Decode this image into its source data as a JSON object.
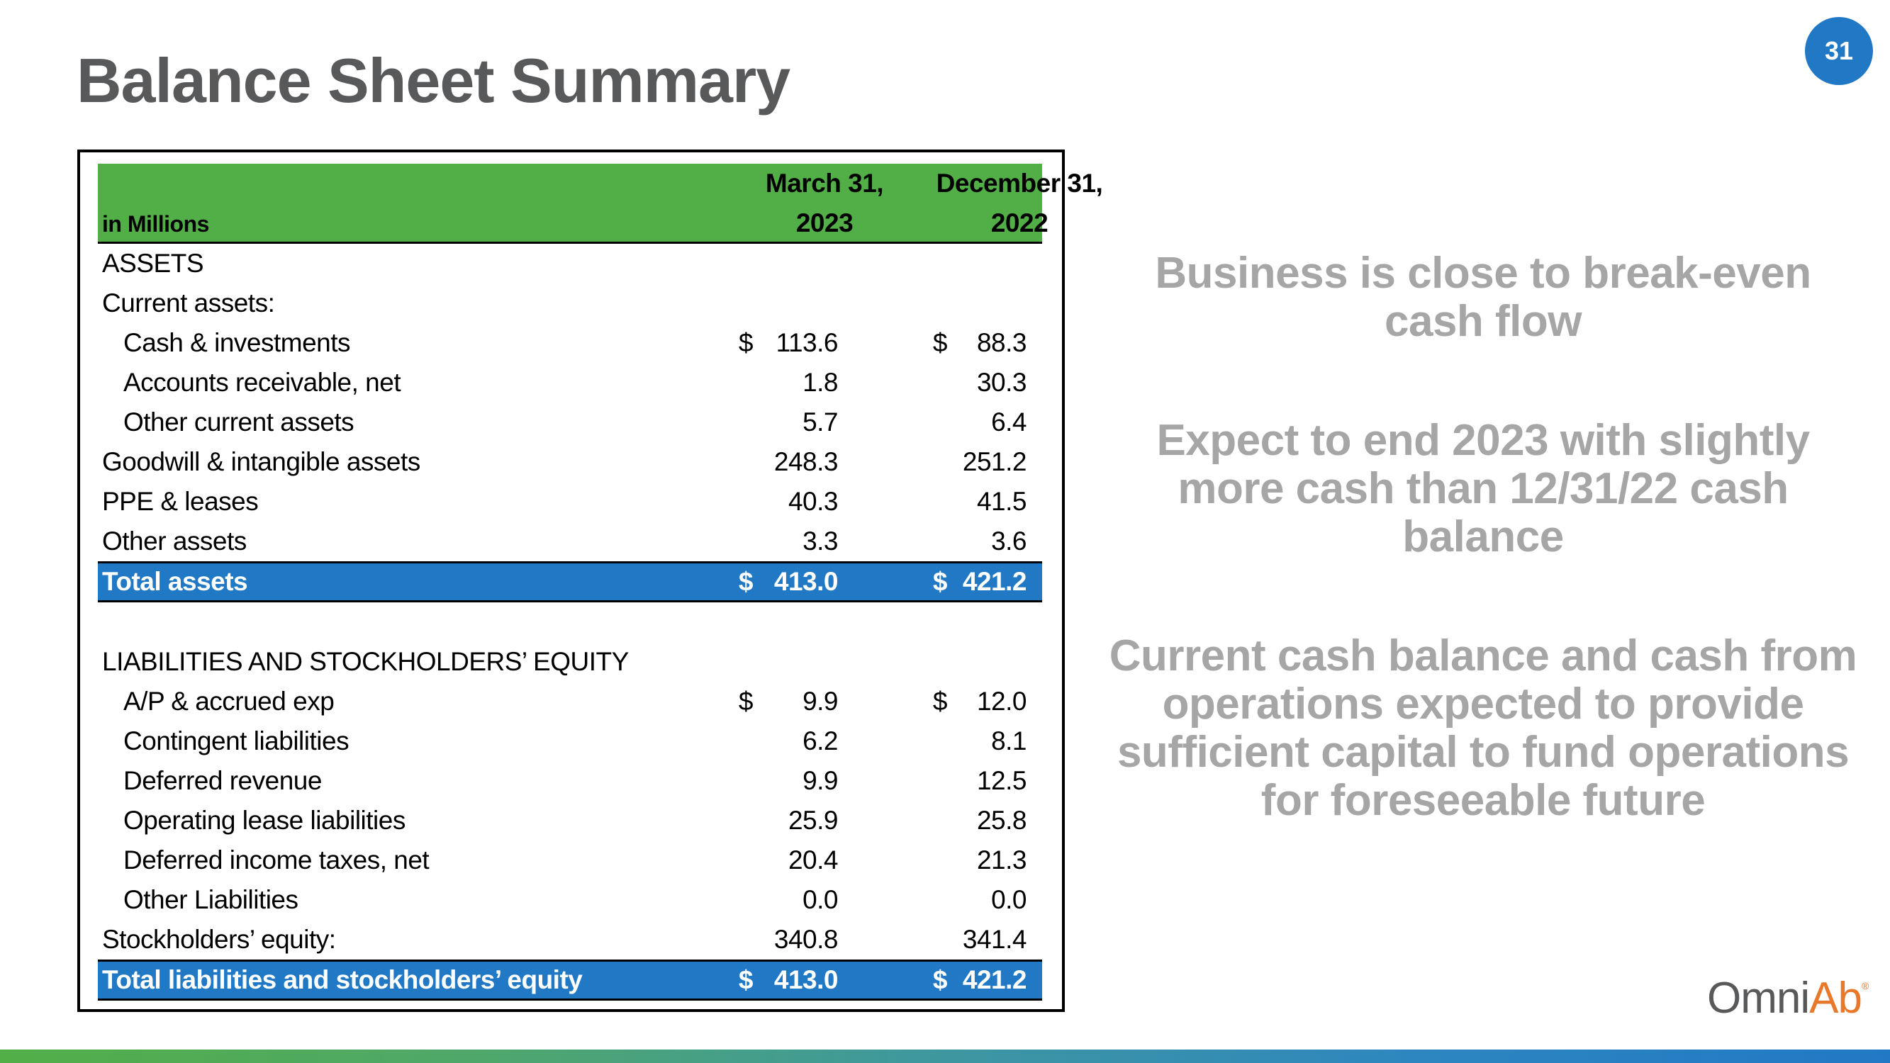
{
  "slide": {
    "title": "Balance Sheet Summary",
    "page_number": "31",
    "colors": {
      "header_green": "#52AE47",
      "total_blue": "#2179C5",
      "title_gray": "#58595B",
      "bullet_gray": "#A6A6A6",
      "logo_orange": "#E8782A"
    }
  },
  "table": {
    "units_label": "in Millions",
    "columns": [
      {
        "line1": "March 31,",
        "line2": "2023"
      },
      {
        "line1": "December 31,",
        "line2": "2022"
      }
    ],
    "rows": [
      {
        "label": "ASSETS",
        "indent": false,
        "cur1": "",
        "v1": "",
        "cur2": "",
        "v2": "",
        "type": "section"
      },
      {
        "label": "Current assets:",
        "indent": false,
        "cur1": "",
        "v1": "",
        "cur2": "",
        "v2": "",
        "type": "subhead"
      },
      {
        "label": "Cash & investments",
        "indent": true,
        "cur1": "$",
        "v1": "113.6",
        "cur2": "$",
        "v2": "88.3",
        "type": "line"
      },
      {
        "label": "Accounts receivable, net",
        "indent": true,
        "cur1": "",
        "v1": "1.8",
        "cur2": "",
        "v2": "30.3",
        "type": "line"
      },
      {
        "label": "Other current assets",
        "indent": true,
        "cur1": "",
        "v1": "5.7",
        "cur2": "",
        "v2": "6.4",
        "type": "line"
      },
      {
        "label": "Goodwill & intangible assets",
        "indent": false,
        "cur1": "",
        "v1": "248.3",
        "cur2": "",
        "v2": "251.2",
        "type": "line"
      },
      {
        "label": "PPE & leases",
        "indent": false,
        "cur1": "",
        "v1": "40.3",
        "cur2": "",
        "v2": "41.5",
        "type": "line"
      },
      {
        "label": "Other assets",
        "indent": false,
        "cur1": "",
        "v1": "3.3",
        "cur2": "",
        "v2": "3.6",
        "type": "line"
      },
      {
        "label": "Total assets",
        "indent": false,
        "cur1": "$",
        "v1": "413.0",
        "cur2": "$",
        "v2": "421.2",
        "type": "total"
      },
      {
        "label": "",
        "indent": false,
        "cur1": "",
        "v1": "",
        "cur2": "",
        "v2": "",
        "type": "spacer"
      },
      {
        "label": "LIABILITIES AND STOCKHOLDERS’ EQUITY",
        "indent": false,
        "cur1": "",
        "v1": "",
        "cur2": "",
        "v2": "",
        "type": "section"
      },
      {
        "label": "A/P & accrued exp",
        "indent": true,
        "cur1": "$",
        "v1": "9.9",
        "cur2": "$",
        "v2": "12.0",
        "type": "line"
      },
      {
        "label": "Contingent liabilities",
        "indent": true,
        "cur1": "",
        "v1": "6.2",
        "cur2": "",
        "v2": "8.1",
        "type": "line"
      },
      {
        "label": "Deferred revenue",
        "indent": true,
        "cur1": "",
        "v1": "9.9",
        "cur2": "",
        "v2": "12.5",
        "type": "line"
      },
      {
        "label": "Operating lease liabilities",
        "indent": true,
        "cur1": "",
        "v1": "25.9",
        "cur2": "",
        "v2": "25.8",
        "type": "line"
      },
      {
        "label": "Deferred income taxes, net",
        "indent": true,
        "cur1": "",
        "v1": "20.4",
        "cur2": "",
        "v2": "21.3",
        "type": "line"
      },
      {
        "label": "Other Liabilities",
        "indent": true,
        "cur1": "",
        "v1": "0.0",
        "cur2": "",
        "v2": "0.0",
        "type": "line"
      },
      {
        "label": "Stockholders’ equity:",
        "indent": false,
        "cur1": "",
        "v1": "340.8",
        "cur2": "",
        "v2": "341.4",
        "type": "line"
      },
      {
        "label": "Total liabilities and stockholders’ equity",
        "indent": false,
        "cur1": "$",
        "v1": "413.0",
        "cur2": "$",
        "v2": "421.2",
        "type": "total"
      }
    ]
  },
  "bullets": [
    "Business is close to break-even cash flow",
    "Expect to end 2023 with slightly more cash than 12/31/22 cash balance",
    "Current cash balance and cash from operations expected to provide sufficient capital to fund operations for foreseeable future"
  ],
  "logo": {
    "part1": "Omni",
    "part2": "Ab",
    "registered": "®"
  }
}
